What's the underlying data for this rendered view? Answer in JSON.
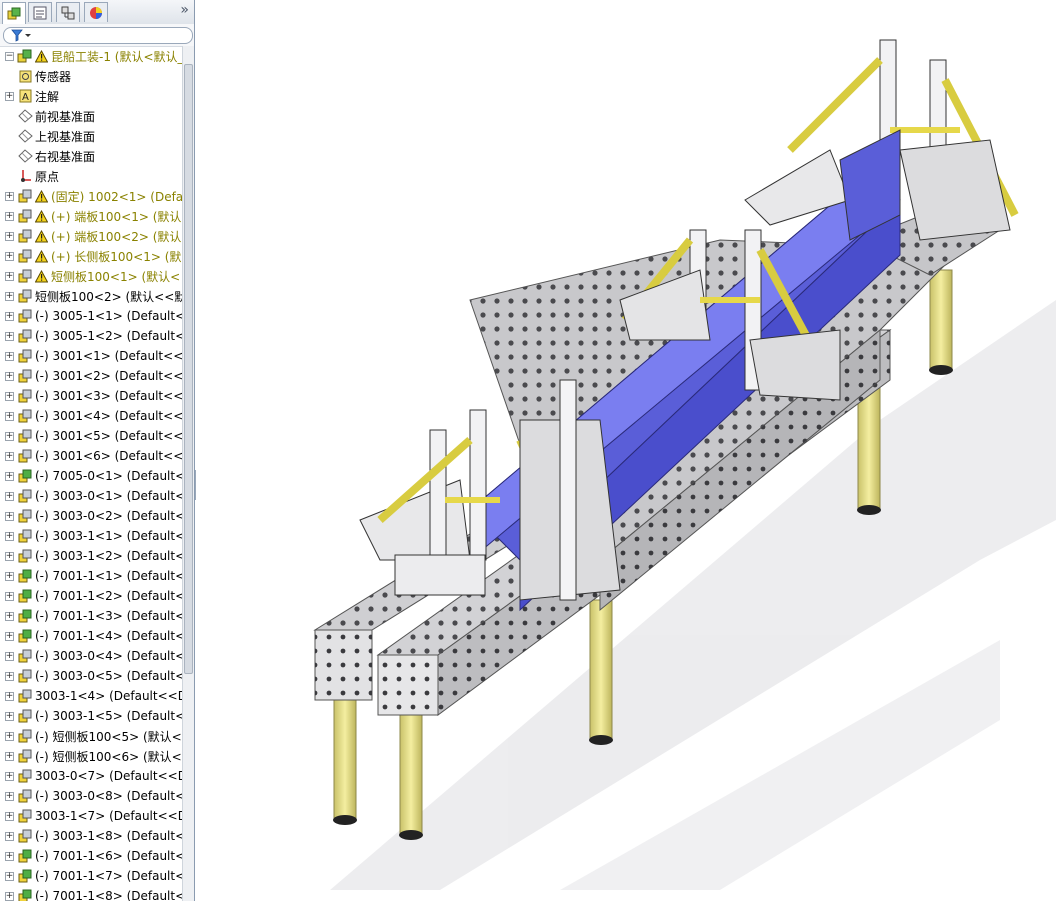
{
  "panel": {
    "tabs": [
      {
        "name": "feature-manager-tab-icon",
        "active": true
      },
      {
        "name": "property-manager-tab-icon",
        "active": false
      },
      {
        "name": "configuration-manager-tab-icon",
        "active": false
      },
      {
        "name": "display-manager-tab-icon",
        "active": false
      }
    ],
    "more_glyph": "»",
    "filter_icon": "funnel-icon"
  },
  "tree": {
    "items": [
      {
        "label": "昆船工装-1 (默认<默认_显",
        "icon": "assembly-icon",
        "warn": true,
        "gold": true,
        "expand": "minus"
      },
      {
        "label": "传感器",
        "icon": "sensor-icon",
        "warn": false,
        "gold": false,
        "expand": "none"
      },
      {
        "label": "注解",
        "icon": "annotation-icon",
        "warn": false,
        "gold": false,
        "expand": "plus"
      },
      {
        "label": "前视基准面",
        "icon": "plane-icon",
        "warn": false,
        "gold": false,
        "expand": "none"
      },
      {
        "label": "上视基准面",
        "icon": "plane-icon",
        "warn": false,
        "gold": false,
        "expand": "none"
      },
      {
        "label": "右视基准面",
        "icon": "plane-icon",
        "warn": false,
        "gold": false,
        "expand": "none"
      },
      {
        "label": "原点",
        "icon": "origin-icon",
        "warn": false,
        "gold": false,
        "expand": "none"
      },
      {
        "label": "(固定) 1002<1> (Defa",
        "icon": "part-icon",
        "warn": true,
        "gold": true,
        "expand": "plus"
      },
      {
        "label": "(+) 端板100<1> (默认",
        "icon": "part-icon",
        "warn": true,
        "gold": true,
        "expand": "plus"
      },
      {
        "label": "(+) 端板100<2> (默认",
        "icon": "part-icon",
        "warn": true,
        "gold": true,
        "expand": "plus"
      },
      {
        "label": "(+) 长侧板100<1> (默",
        "icon": "part-icon",
        "warn": true,
        "gold": true,
        "expand": "plus"
      },
      {
        "label": "短侧板100<1> (默认<",
        "icon": "part-icon",
        "warn": true,
        "gold": true,
        "expand": "plus"
      },
      {
        "label": "短侧板100<2> (默认<<默",
        "icon": "part-icon",
        "warn": false,
        "gold": false,
        "expand": "plus"
      },
      {
        "label": "(-) 3005-1<1> (Default<",
        "icon": "part-icon",
        "warn": false,
        "gold": false,
        "expand": "plus"
      },
      {
        "label": "(-) 3005-1<2> (Default<",
        "icon": "part-icon",
        "warn": false,
        "gold": false,
        "expand": "plus"
      },
      {
        "label": "(-) 3001<1> (Default<<",
        "icon": "part-icon",
        "warn": false,
        "gold": false,
        "expand": "plus"
      },
      {
        "label": "(-) 3001<2> (Default<<",
        "icon": "part-icon",
        "warn": false,
        "gold": false,
        "expand": "plus"
      },
      {
        "label": "(-) 3001<3> (Default<<",
        "icon": "part-icon",
        "warn": false,
        "gold": false,
        "expand": "plus"
      },
      {
        "label": "(-) 3001<4> (Default<<",
        "icon": "part-icon",
        "warn": false,
        "gold": false,
        "expand": "plus"
      },
      {
        "label": "(-) 3001<5> (Default<<",
        "icon": "part-icon",
        "warn": false,
        "gold": false,
        "expand": "plus"
      },
      {
        "label": "(-) 3001<6> (Default<<",
        "icon": "part-icon",
        "warn": false,
        "gold": false,
        "expand": "plus"
      },
      {
        "label": "(-) 7005-0<1> (Default<",
        "icon": "subassembly-icon",
        "warn": false,
        "gold": false,
        "expand": "plus"
      },
      {
        "label": "(-) 3003-0<1> (Default<",
        "icon": "part-icon",
        "warn": false,
        "gold": false,
        "expand": "plus"
      },
      {
        "label": "(-) 3003-0<2> (Default<",
        "icon": "part-icon",
        "warn": false,
        "gold": false,
        "expand": "plus"
      },
      {
        "label": "(-) 3003-1<1> (Default<",
        "icon": "part-icon",
        "warn": false,
        "gold": false,
        "expand": "plus"
      },
      {
        "label": "(-) 3003-1<2> (Default<",
        "icon": "part-icon",
        "warn": false,
        "gold": false,
        "expand": "plus"
      },
      {
        "label": "(-) 7001-1<1> (Default<",
        "icon": "subassembly-icon",
        "warn": false,
        "gold": false,
        "expand": "plus"
      },
      {
        "label": "(-) 7001-1<2> (Default<",
        "icon": "subassembly-icon",
        "warn": false,
        "gold": false,
        "expand": "plus"
      },
      {
        "label": "(-) 7001-1<3> (Default<",
        "icon": "subassembly-icon",
        "warn": false,
        "gold": false,
        "expand": "plus"
      },
      {
        "label": "(-) 7001-1<4> (Default<",
        "icon": "subassembly-icon",
        "warn": false,
        "gold": false,
        "expand": "plus"
      },
      {
        "label": "(-) 3003-0<4> (Default<",
        "icon": "part-icon",
        "warn": false,
        "gold": false,
        "expand": "plus"
      },
      {
        "label": "(-) 3003-0<5> (Default<",
        "icon": "part-icon",
        "warn": false,
        "gold": false,
        "expand": "plus"
      },
      {
        "label": "3003-1<4> (Default<<D",
        "icon": "part-icon",
        "warn": false,
        "gold": false,
        "expand": "plus"
      },
      {
        "label": "(-) 3003-1<5> (Default<",
        "icon": "part-icon",
        "warn": false,
        "gold": false,
        "expand": "plus"
      },
      {
        "label": "(-) 短侧板100<5> (默认<",
        "icon": "part-icon",
        "warn": false,
        "gold": false,
        "expand": "plus"
      },
      {
        "label": "(-) 短侧板100<6> (默认<",
        "icon": "part-icon",
        "warn": false,
        "gold": false,
        "expand": "plus"
      },
      {
        "label": "3003-0<7> (Default<<D",
        "icon": "part-icon",
        "warn": false,
        "gold": false,
        "expand": "plus"
      },
      {
        "label": "(-) 3003-0<8> (Default<",
        "icon": "part-icon",
        "warn": false,
        "gold": false,
        "expand": "plus"
      },
      {
        "label": "3003-1<7> (Default<<D",
        "icon": "part-icon",
        "warn": false,
        "gold": false,
        "expand": "plus"
      },
      {
        "label": "(-) 3003-1<8> (Default<",
        "icon": "part-icon",
        "warn": false,
        "gold": false,
        "expand": "plus"
      },
      {
        "label": "(-) 7001-1<6> (Default<",
        "icon": "subassembly-icon",
        "warn": false,
        "gold": false,
        "expand": "plus"
      },
      {
        "label": "(-) 7001-1<7> (Default<",
        "icon": "subassembly-icon",
        "warn": false,
        "gold": false,
        "expand": "plus"
      },
      {
        "label": "(-) 7001-1<8> (Default<",
        "icon": "subassembly-icon",
        "warn": false,
        "gold": false,
        "expand": "plus"
      }
    ]
  },
  "colors": {
    "panel_border": "#8a9bb0",
    "gold_text": "#8a8200",
    "table_steel": "#d4d4d6",
    "leg_yellow": "#e8e08a",
    "blue_part": "#6a6ee6"
  }
}
